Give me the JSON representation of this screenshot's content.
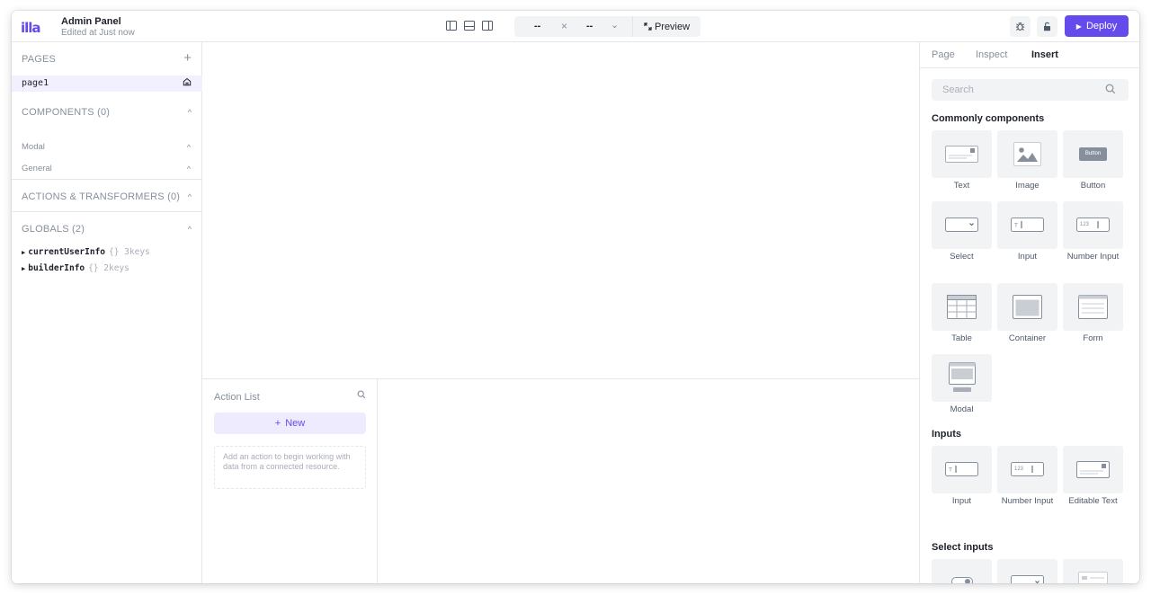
{
  "header": {
    "logo": "illa",
    "app_title": "Admin Panel",
    "app_subtitle": "Edited at Just now",
    "viewport_width": "--",
    "viewport_height": "--",
    "clear_symbol": "×",
    "dropdown_symbol": "⌄",
    "preview_label": "Preview",
    "deploy_label": "Deploy"
  },
  "left": {
    "pages_title": "PAGES",
    "pages": [
      {
        "label": "page1"
      }
    ],
    "components_title": "COMPONENTS (0)",
    "component_groups": [
      "Modal",
      "General"
    ],
    "actions_title": "ACTIONS & TRANSFORMERS (0)",
    "globals_title": "GLOBALS (2)",
    "globals": [
      {
        "key": "currentUserInfo",
        "meta": "{} 3keys"
      },
      {
        "key": "builderInfo",
        "meta": "{} 2keys"
      }
    ]
  },
  "actions": {
    "title": "Action List",
    "new_label": "New",
    "empty_text": "Add an action to begin working with data from a connected resource."
  },
  "right": {
    "tabs": [
      "Page",
      "Inspect",
      "Insert"
    ],
    "active_tab": "Insert",
    "search_placeholder": "Search",
    "categories": [
      {
        "title": "Commonly components",
        "items": [
          "Text",
          "Image",
          "Button",
          "Select",
          "Input",
          "Number Input",
          "Table",
          "Container",
          "Form",
          "Modal"
        ]
      },
      {
        "title": "Inputs",
        "items": [
          "Input",
          "Number Input",
          "Editable Text"
        ]
      },
      {
        "title": "Select inputs",
        "items": []
      }
    ],
    "button_preview_text": "Button",
    "number_preview_text": "123"
  },
  "colors": {
    "accent": "#654aec",
    "accent_light": "#eeebfe",
    "tile_bg": "#f2f3f5",
    "border": "#e5e6eb",
    "muted_text": "#86909c"
  }
}
